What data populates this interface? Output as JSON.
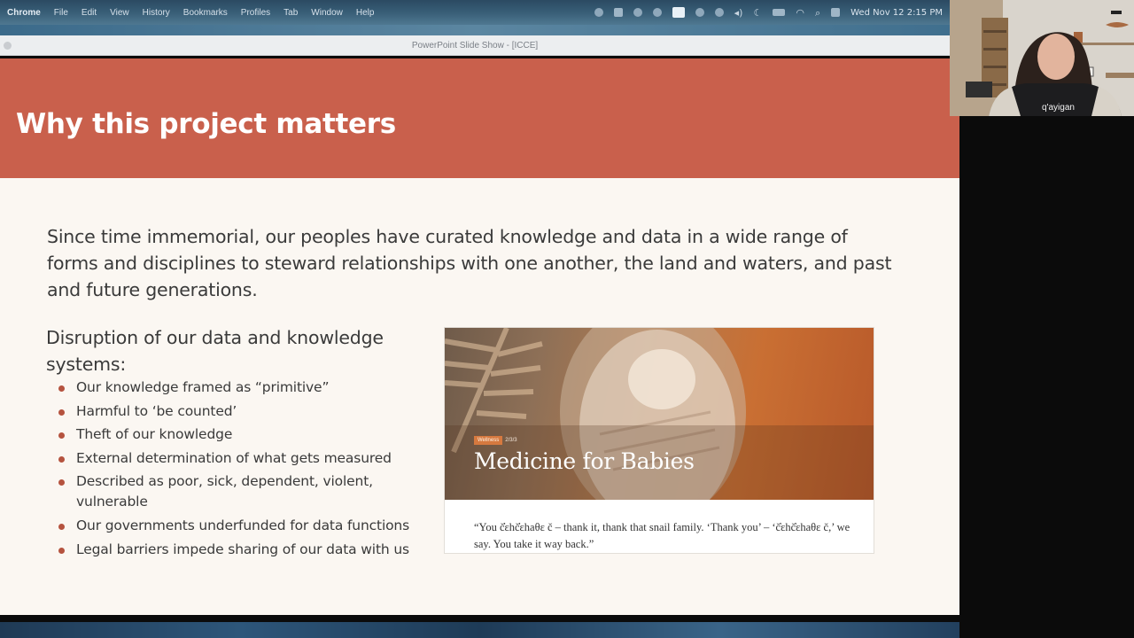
{
  "menubar": {
    "app": "Chrome",
    "items": [
      "File",
      "Edit",
      "View",
      "History",
      "Bookmarks",
      "Profiles",
      "Tab",
      "Window",
      "Help"
    ],
    "clock": "Wed Nov 12  2:15 PM"
  },
  "window": {
    "title": "PowerPoint Slide Show - [ICCE]"
  },
  "slide": {
    "title": "Why this project matters",
    "intro": "Since time immemorial, our peoples have curated knowledge and data in a wide range of forms and disciplines to steward relationships with one another, the land and waters, and past and future generations.",
    "disruption_heading": "Disruption of our data and knowledge systems:",
    "bullets": [
      "Our knowledge framed as “primitive”",
      "Harmful to ‘be counted’",
      "Theft of our knowledge",
      "External determination of what gets measured",
      "Described as poor, sick, dependent, violent, vulnerable",
      "Our governments underfunded for data functions",
      "Legal barriers impede sharing of our data with us"
    ],
    "card": {
      "tag": "Wellness",
      "tag_date": "2/3/3",
      "title": "Medicine for Babies",
      "quote": "“You č̓ɛhč̓ɛhaθɛ č – thank it, thank that snail family. ‘Thank you’ – ‘č̓ɛhč̓ɛhaθɛ č,’ we say. You take it way back.”"
    }
  },
  "webcam": {
    "shirt_text": "q'ayigan"
  },
  "colors": {
    "header": "#c9604c",
    "bullet": "#b5533f",
    "slide_bg": "#fbf7f2"
  }
}
